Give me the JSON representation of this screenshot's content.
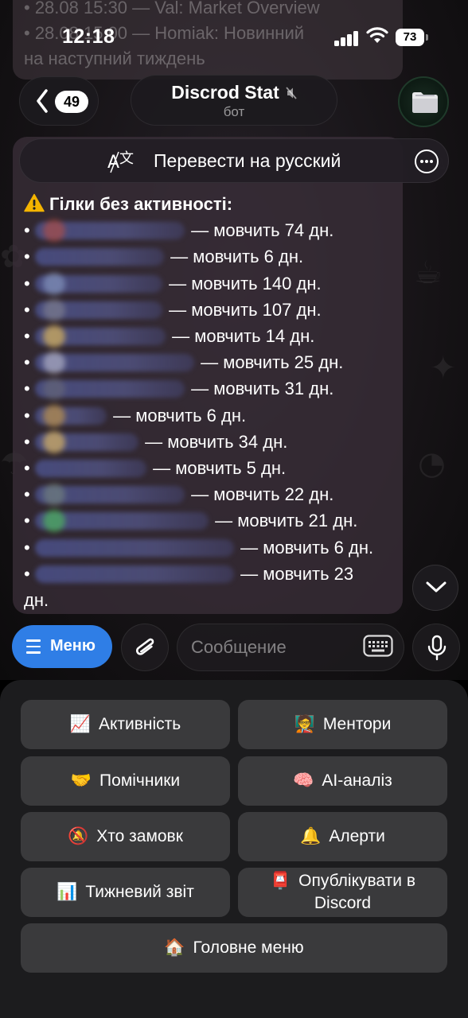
{
  "status_bar": {
    "time": "12:18",
    "battery": "73"
  },
  "previous_message": {
    "line1": "• 28.08 15:30 — Val: Market Overview",
    "line2": "• 28.08 15:00 — Homiak: Новинний",
    "line3": "на наступний тиждень"
  },
  "header": {
    "unread_count": "49",
    "chat_title": "Discrod Stat",
    "chat_subtitle": "бот"
  },
  "translate_bar": {
    "label": "Перевести на русский"
  },
  "message": {
    "heading": "Гілки без активності:",
    "rows": [
      {
        "text": " — мовчить 74 дн."
      },
      {
        "text": " — мовчить 6 дн."
      },
      {
        "text": " — мовчить 140 дн."
      },
      {
        "text": " — мовчить 107 дн."
      },
      {
        "text": " — мовчить 14 дн."
      },
      {
        "text": " — мовчить 25 дн."
      },
      {
        "text": " — мовчить 31 дн."
      },
      {
        "text": " — мовчить 6 дн."
      },
      {
        "text": " — мовчить 34 дн."
      },
      {
        "text": " — мовчить 5 дн."
      },
      {
        "text": " — мовчить 22 дн."
      },
      {
        "text": " — мовчить 21 дн."
      },
      {
        "text": " — мовчить 6 дн."
      },
      {
        "text": " — мовчить 23"
      }
    ],
    "last_word": "дн."
  },
  "input_bar": {
    "menu_label": "Меню",
    "placeholder": "Сообщение"
  },
  "bot_keyboard": {
    "activity": {
      "emoji": "📈",
      "label": "Активність"
    },
    "mentors": {
      "emoji": "🧑‍🏫",
      "label": "Ментори"
    },
    "helpers": {
      "emoji": "🤝",
      "label": "Помічники"
    },
    "ai_analysis": {
      "emoji": "🧠",
      "label": "AI-аналіз"
    },
    "who_silent": {
      "emoji": "🔕",
      "label": "Хто замовк"
    },
    "alerts": {
      "emoji": "🔔",
      "label": "Алерти"
    },
    "weekly_report": {
      "emoji": "📊",
      "label": "Тижневий звіт"
    },
    "publish_discord": {
      "emoji": "📮",
      "label_line1": "Опублікувати в",
      "label_line2": "Discord"
    },
    "main_menu": {
      "emoji": "🏠",
      "label": "Головне меню"
    }
  },
  "colors": {
    "menu_button": "#2f7ee6",
    "keyboard_button": "#3a3a3c",
    "keyboard_bg": "#1c1c1e"
  }
}
